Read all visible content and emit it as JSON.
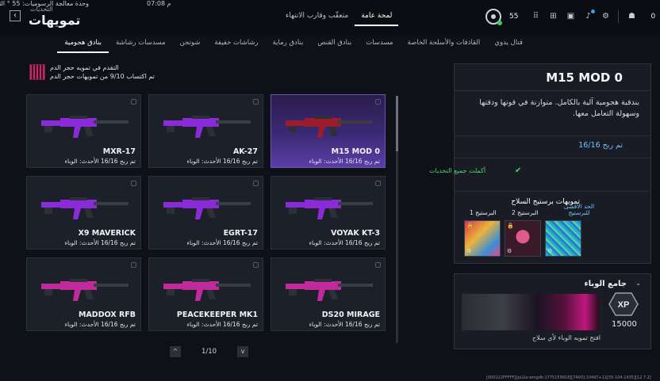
{
  "perf": {
    "text": "وحدة معالجة الرسوميات: 55 ° الثانية",
    "time": "07:08 م"
  },
  "page": {
    "subtitle": "التحديات",
    "title": "تمويهات"
  },
  "top_tabs": [
    {
      "label": "متعقّب وقارب الانتهاء",
      "active": false
    },
    {
      "label": "لمحة عامة",
      "active": true
    }
  ],
  "status": {
    "level": "55",
    "friends": "0"
  },
  "categories": [
    {
      "label": "قتال يدوي",
      "active": false
    },
    {
      "label": "القاذفات والأسلحة الخاصة",
      "active": false
    },
    {
      "label": "مسدسات",
      "active": false
    },
    {
      "label": "بنادق القنص",
      "active": false
    },
    {
      "label": "بنادق رماية",
      "active": false
    },
    {
      "label": "رشاشات خفيفة",
      "active": false
    },
    {
      "label": "شوتجن",
      "active": false
    },
    {
      "label": "مسدسات رشاشة",
      "active": false
    },
    {
      "label": "بنادق هجومية",
      "active": true
    }
  ],
  "progress": {
    "line1": "التقدم في تمويه حجر الدم",
    "line2": "تم اكتساب 9/10 من تمويهات حجر الدم"
  },
  "weapons": [
    {
      "name": "M15 MOD 0",
      "sub": "تم ربح 16/16  الأحدث: الوباء",
      "selected": true,
      "color": "#9b1c2a"
    },
    {
      "name": "AK-27",
      "sub": "تم ربح 16/16  الأحدث: الوباء",
      "selected": false,
      "color": "#8b2ad8"
    },
    {
      "name": "MXR-17",
      "sub": "تم ربح 16/16  الأحدث: الوباء",
      "selected": false,
      "color": "#8b2ad8"
    },
    {
      "name": "VOYAK KT-3",
      "sub": "تم ربح 16/16  الأحدث: الوباء",
      "selected": false,
      "color": "#8b2ad8"
    },
    {
      "name": "EGRT-17",
      "sub": "تم ربح 16/16  الأحدث: الوباء",
      "selected": false,
      "color": "#8b2ad8"
    },
    {
      "name": "X9 MAVERICK",
      "sub": "تم ربح 16/16  الأحدث: الوباء",
      "selected": false,
      "color": "#8b2ad8"
    },
    {
      "name": "DS20 MIRAGE",
      "sub": "تم ربح 16/16  الأحدث: الوباء",
      "selected": false,
      "color": "#c02a9a"
    },
    {
      "name": "PEACEKEEPER MK1",
      "sub": "تم ربح 16/16  الأحدث: الوباء",
      "selected": false,
      "color": "#c02a9a"
    },
    {
      "name": "MADDOX RFB",
      "sub": "تم ربح 16/16  الأحدث: الوباء",
      "selected": false,
      "color": "#c02a9a"
    }
  ],
  "pager": {
    "text": "1/10",
    "up": "^",
    "down": "v"
  },
  "detail": {
    "title": "M15 MOD 0",
    "description": "بندقية هجومية آلية بالكامل. متوازنة في قوتها ودقتها وسهولة التعامل معها.",
    "earned": "تم ربح 16/16",
    "completed": "أكملت جميع التحديات",
    "mastery_title": "تمويهات برستيج السلاح",
    "mastery": [
      {
        "label": "الحد الأقصى للبرستيج",
        "highlight": true
      },
      {
        "label": "البرستيج 2",
        "highlight": false
      },
      {
        "label": "البرستيج 1",
        "highlight": false
      }
    ]
  },
  "xp_card": {
    "title": "جامع الوباء",
    "xp_label": "XP",
    "value": "15000",
    "description": "افتح تمويه الوباء لأي سلاح"
  },
  "footer": "[000122FFFFF][pLGa:wingdk:1775159918][7400]:10497+11[55-104.1435][12.7.2]"
}
